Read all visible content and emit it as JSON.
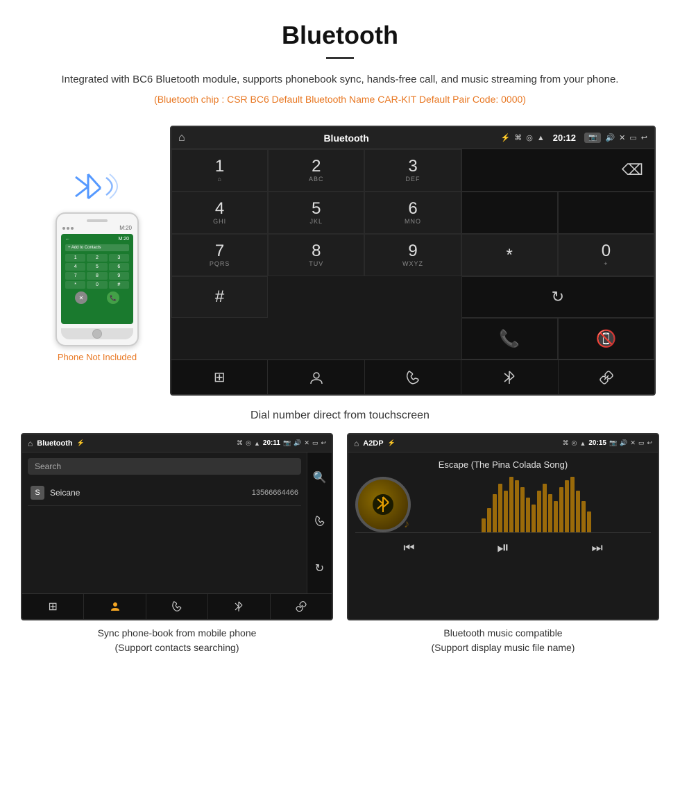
{
  "header": {
    "title": "Bluetooth",
    "description": "Integrated with BC6 Bluetooth module, supports phonebook sync, hands-free call, and music streaming from your phone.",
    "specs": "(Bluetooth chip : CSR BC6    Default Bluetooth Name CAR-KIT    Default Pair Code: 0000)"
  },
  "phone_label": "Phone Not Included",
  "dial_screen": {
    "status_bar": {
      "title": "Bluetooth",
      "time": "20:12"
    },
    "keys": [
      {
        "num": "1",
        "sub": "⌂ "
      },
      {
        "num": "2",
        "sub": "ABC"
      },
      {
        "num": "3",
        "sub": "DEF"
      },
      {
        "num": "4",
        "sub": "GHI"
      },
      {
        "num": "5",
        "sub": "JKL"
      },
      {
        "num": "6",
        "sub": "MNO"
      },
      {
        "num": "7",
        "sub": "PQRS"
      },
      {
        "num": "8",
        "sub": "TUV"
      },
      {
        "num": "9",
        "sub": "WXYZ"
      },
      {
        "num": "*",
        "sub": ""
      },
      {
        "num": "0",
        "sub": "+"
      },
      {
        "num": "#",
        "sub": ""
      }
    ],
    "toolbar": {
      "dialpad": "⊞",
      "contacts": "👤",
      "phone": "📞",
      "bluetooth": "⌘",
      "link": "🔗"
    }
  },
  "main_caption": "Dial number direct from touchscreen",
  "phonebook_screen": {
    "status_bar": {
      "title": "Bluetooth",
      "time": "20:11"
    },
    "search_placeholder": "Search",
    "contacts": [
      {
        "letter": "S",
        "name": "Seicane",
        "number": "13566664466"
      }
    ]
  },
  "music_screen": {
    "status_bar": {
      "title": "A2DP",
      "time": "20:15"
    },
    "song_title": "Escape (The Pina Colada Song)",
    "eq_bars": [
      20,
      35,
      55,
      70,
      60,
      80,
      75,
      65,
      50,
      40,
      60,
      70,
      55,
      45,
      65,
      75,
      80,
      60,
      45,
      30
    ]
  },
  "bottom_caption_left": "Sync phone-book from mobile phone\n(Support contacts searching)",
  "bottom_caption_right": "Bluetooth music compatible\n(Support display music file name)"
}
